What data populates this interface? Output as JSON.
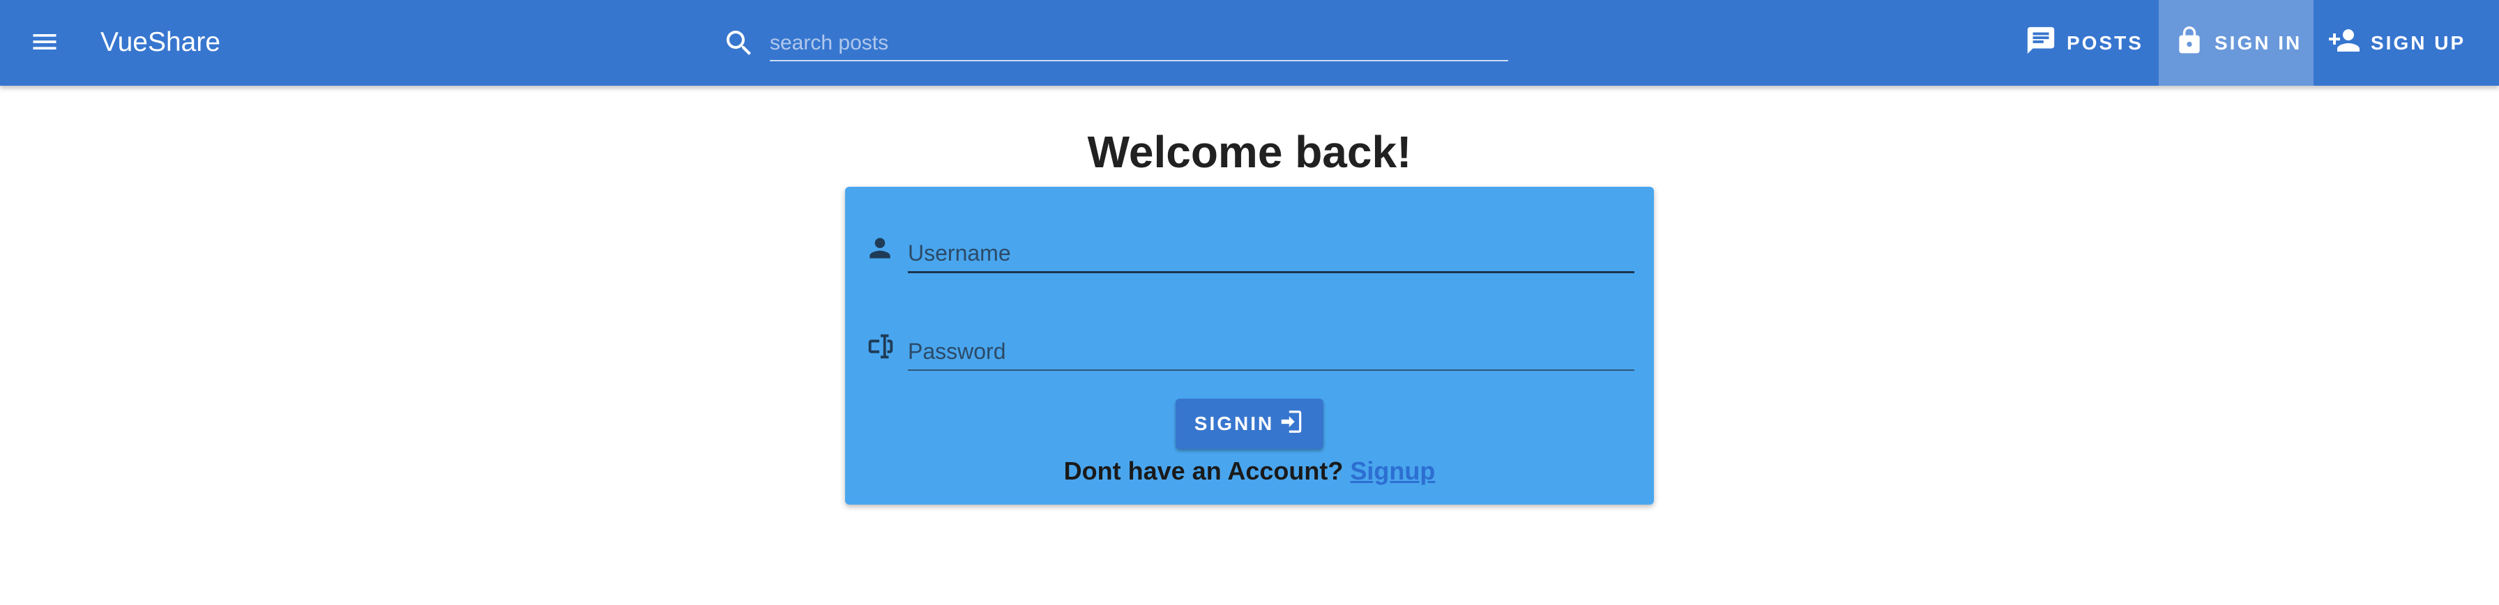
{
  "appbar": {
    "title": "VueShare",
    "search": {
      "placeholder": "search posts",
      "value": ""
    },
    "nav": {
      "posts": "POSTS",
      "signin": "SIGN IN",
      "signup": "SIGN UP"
    },
    "icons": {
      "menu": "menu-icon",
      "search": "search-icon",
      "posts": "chat-icon",
      "signin": "lock-icon",
      "signup": "person-add-icon"
    }
  },
  "main": {
    "heading": "Welcome back!",
    "form": {
      "username_placeholder": "Username",
      "password_placeholder": "Password",
      "submit_label": "SIGNIN",
      "account_text": "Dont have an Account?",
      "signup_link": "Signup"
    }
  },
  "colors": {
    "appbar": "#3776cf",
    "card": "#49a6ee",
    "button": "#3776cf",
    "link": "#2d6ed1"
  }
}
